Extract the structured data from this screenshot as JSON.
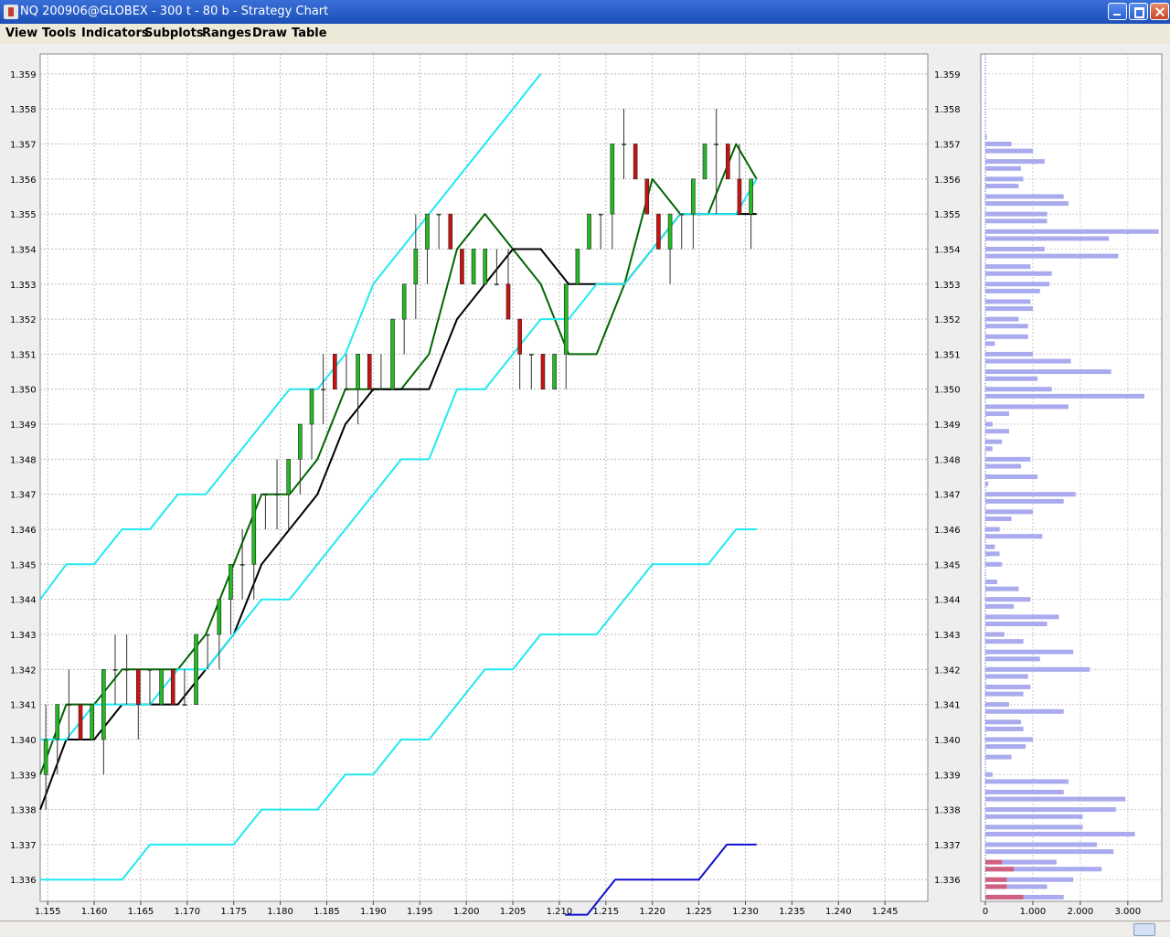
{
  "window": {
    "title": "NQ 200906@GLOBEX - 300 t - 80 b - Strategy Chart"
  },
  "menu": {
    "items": [
      "View",
      "Tools",
      "Indicators",
      "Subplots",
      "Ranges",
      "Draw",
      "Table"
    ]
  },
  "colors": {
    "bull_candle": "#22bb22",
    "bear_candle": "#cc1111",
    "band": "#22e8f0",
    "fast_ma": "#006600",
    "slow_ma": "#000000",
    "low_band": "#1010d0",
    "volume_bar": "#aaaaee",
    "volume_highlight": "#d06080"
  },
  "chart_data": [
    {
      "type": "candlestick",
      "title": "",
      "xlabel": "",
      "ylabel": "",
      "x_ticks": [
        "1.155",
        "1.160",
        "1.165",
        "1.170",
        "1.175",
        "1.180",
        "1.185",
        "1.190",
        "1.195",
        "1.200",
        "1.205",
        "1.210",
        "1.215",
        "1.220",
        "1.225",
        "1.230",
        "1.235",
        "1.240",
        "1.245"
      ],
      "y_ticks": [
        "1.336",
        "1.337",
        "1.338",
        "1.339",
        "1.340",
        "1.341",
        "1.342",
        "1.343",
        "1.344",
        "1.345",
        "1.346",
        "1.347",
        "1.348",
        "1.349",
        "1.350",
        "1.351",
        "1.352",
        "1.353",
        "1.354",
        "1.355",
        "1.356",
        "1.357",
        "1.358",
        "1.359"
      ],
      "xlim": [
        1.1542,
        1.2496
      ],
      "ylim": [
        1.33538,
        1.35957
      ],
      "grid": true,
      "candles": [
        [
          1.339,
          1.341,
          1.338,
          1.34
        ],
        [
          1.34,
          1.341,
          1.339,
          1.341
        ],
        [
          1.341,
          1.342,
          1.34,
          1.341
        ],
        [
          1.341,
          1.341,
          1.34,
          1.34
        ],
        [
          1.34,
          1.341,
          1.34,
          1.341
        ],
        [
          1.34,
          1.342,
          1.339,
          1.342
        ],
        [
          1.342,
          1.343,
          1.341,
          1.342
        ],
        [
          1.342,
          1.343,
          1.341,
          1.342
        ],
        [
          1.342,
          1.342,
          1.34,
          1.341
        ],
        [
          1.342,
          1.342,
          1.341,
          1.342
        ],
        [
          1.341,
          1.342,
          1.341,
          1.342
        ],
        [
          1.342,
          1.342,
          1.341,
          1.341
        ],
        [
          1.341,
          1.342,
          1.341,
          1.341
        ],
        [
          1.341,
          1.343,
          1.341,
          1.343
        ],
        [
          1.343,
          1.343,
          1.342,
          1.343
        ],
        [
          1.343,
          1.344,
          1.342,
          1.344
        ],
        [
          1.344,
          1.345,
          1.343,
          1.345
        ],
        [
          1.345,
          1.346,
          1.344,
          1.345
        ],
        [
          1.345,
          1.347,
          1.344,
          1.347
        ],
        [
          1.347,
          1.347,
          1.346,
          1.347
        ],
        [
          1.347,
          1.348,
          1.346,
          1.347
        ],
        [
          1.347,
          1.348,
          1.346,
          1.348
        ],
        [
          1.348,
          1.349,
          1.347,
          1.349
        ],
        [
          1.349,
          1.35,
          1.348,
          1.35
        ],
        [
          1.35,
          1.351,
          1.349,
          1.35
        ],
        [
          1.351,
          1.351,
          1.35,
          1.35
        ],
        [
          1.35,
          1.351,
          1.35,
          1.35
        ],
        [
          1.35,
          1.351,
          1.349,
          1.351
        ],
        [
          1.351,
          1.351,
          1.35,
          1.35
        ],
        [
          1.35,
          1.351,
          1.35,
          1.35
        ],
        [
          1.35,
          1.352,
          1.35,
          1.352
        ],
        [
          1.352,
          1.353,
          1.351,
          1.353
        ],
        [
          1.353,
          1.355,
          1.352,
          1.354
        ],
        [
          1.354,
          1.355,
          1.353,
          1.355
        ],
        [
          1.355,
          1.355,
          1.354,
          1.355
        ],
        [
          1.355,
          1.355,
          1.354,
          1.354
        ],
        [
          1.354,
          1.354,
          1.353,
          1.353
        ],
        [
          1.353,
          1.354,
          1.353,
          1.354
        ],
        [
          1.353,
          1.354,
          1.353,
          1.354
        ],
        [
          1.353,
          1.354,
          1.353,
          1.353
        ],
        [
          1.353,
          1.354,
          1.352,
          1.352
        ],
        [
          1.352,
          1.352,
          1.35,
          1.351
        ],
        [
          1.351,
          1.351,
          1.35,
          1.351
        ],
        [
          1.351,
          1.351,
          1.35,
          1.35
        ],
        [
          1.35,
          1.351,
          1.35,
          1.351
        ],
        [
          1.351,
          1.353,
          1.35,
          1.353
        ],
        [
          1.353,
          1.354,
          1.353,
          1.354
        ],
        [
          1.354,
          1.355,
          1.354,
          1.355
        ],
        [
          1.355,
          1.355,
          1.354,
          1.355
        ],
        [
          1.355,
          1.357,
          1.354,
          1.357
        ],
        [
          1.357,
          1.358,
          1.356,
          1.357
        ],
        [
          1.357,
          1.357,
          1.356,
          1.356
        ],
        [
          1.356,
          1.356,
          1.355,
          1.355
        ],
        [
          1.355,
          1.355,
          1.354,
          1.354
        ],
        [
          1.354,
          1.355,
          1.353,
          1.355
        ],
        [
          1.355,
          1.355,
          1.354,
          1.355
        ],
        [
          1.355,
          1.356,
          1.354,
          1.356
        ],
        [
          1.356,
          1.357,
          1.356,
          1.357
        ],
        [
          1.357,
          1.358,
          1.355,
          1.357
        ],
        [
          1.357,
          1.357,
          1.356,
          1.356
        ],
        [
          1.356,
          1.357,
          1.355,
          1.355
        ],
        [
          1.355,
          1.356,
          1.354,
          1.356
        ]
      ],
      "series": [
        {
          "x": [
            1.1542,
            1.157,
            1.16,
            1.163,
            1.166,
            1.169,
            1.172,
            1.175,
            1.178,
            1.181,
            1.184,
            1.187,
            1.19,
            1.193,
            1.196,
            1.199,
            1.202,
            1.205,
            1.208,
            1.211,
            1.214,
            1.217,
            1.22,
            1.223,
            1.226,
            1.229,
            1.2312
          ],
          "y": [
            1.339,
            1.341,
            1.341,
            1.342,
            1.342,
            1.342,
            1.343,
            1.345,
            1.347,
            1.347,
            1.348,
            1.35,
            1.35,
            1.35,
            1.351,
            1.354,
            1.355,
            1.354,
            1.353,
            1.351,
            1.351,
            1.353,
            1.356,
            1.355,
            1.355,
            1.357,
            1.356
          ]
        },
        {
          "x": [
            1.1542,
            1.157,
            1.16,
            1.163,
            1.166,
            1.169,
            1.172,
            1.175,
            1.178,
            1.181,
            1.184,
            1.187,
            1.19,
            1.193,
            1.196,
            1.199,
            1.202,
            1.205,
            1.208,
            1.211,
            1.214,
            1.217,
            1.22,
            1.223,
            1.226,
            1.229,
            1.2312
          ],
          "y": [
            1.338,
            1.34,
            1.34,
            1.341,
            1.341,
            1.341,
            1.342,
            1.343,
            1.345,
            1.346,
            1.347,
            1.349,
            1.35,
            1.35,
            1.35,
            1.352,
            1.353,
            1.354,
            1.354,
            1.353,
            1.353,
            1.353,
            1.354,
            1.355,
            1.355,
            1.355,
            1.355
          ]
        },
        {
          "x": [
            1.1542,
            1.157,
            1.16,
            1.163,
            1.166,
            1.169,
            1.172,
            1.175,
            1.178,
            1.181,
            1.184,
            1.187,
            1.19,
            1.193,
            1.196,
            1.199,
            1.202,
            1.205,
            1.208
          ],
          "y": [
            1.344,
            1.345,
            1.345,
            1.346,
            1.346,
            1.347,
            1.347,
            1.348,
            1.349,
            1.35,
            1.35,
            1.351,
            1.353,
            1.354,
            1.355,
            1.356,
            1.357,
            1.358,
            1.359
          ]
        },
        {
          "x": [
            1.1542,
            1.157,
            1.16,
            1.163,
            1.166,
            1.169,
            1.172,
            1.175,
            1.178,
            1.181,
            1.184,
            1.187,
            1.19,
            1.193,
            1.196,
            1.199,
            1.202,
            1.205,
            1.208,
            1.211,
            1.214,
            1.217,
            1.22,
            1.223,
            1.226,
            1.229,
            1.2312
          ],
          "y": [
            1.34,
            1.34,
            1.341,
            1.341,
            1.341,
            1.342,
            1.342,
            1.343,
            1.344,
            1.344,
            1.345,
            1.346,
            1.347,
            1.348,
            1.348,
            1.35,
            1.35,
            1.351,
            1.352,
            1.352,
            1.353,
            1.353,
            1.354,
            1.355,
            1.355,
            1.355,
            1.356
          ]
        },
        {
          "x": [
            1.1542,
            1.157,
            1.16,
            1.163,
            1.166,
            1.169,
            1.172,
            1.175,
            1.178,
            1.181,
            1.184,
            1.187,
            1.19,
            1.193,
            1.196,
            1.199,
            1.202,
            1.205,
            1.208,
            1.211,
            1.214,
            1.217,
            1.22,
            1.223,
            1.226,
            1.229,
            1.2312
          ],
          "y": [
            1.336,
            1.336,
            1.336,
            1.336,
            1.337,
            1.337,
            1.337,
            1.337,
            1.338,
            1.338,
            1.338,
            1.339,
            1.339,
            1.34,
            1.34,
            1.341,
            1.342,
            1.342,
            1.343,
            1.343,
            1.343,
            1.344,
            1.345,
            1.345,
            1.345,
            1.346,
            1.346
          ]
        },
        {
          "x": [
            1.2106,
            1.213,
            1.216,
            1.219,
            1.222,
            1.225,
            1.228,
            1.2312
          ],
          "y": [
            1.335,
            1.335,
            1.336,
            1.336,
            1.336,
            1.336,
            1.337,
            1.337
          ]
        }
      ]
    },
    {
      "type": "bar",
      "orientation": "horizontal",
      "title": "",
      "xlabel": "",
      "ylabel": "",
      "x_ticks": [
        "0",
        "1.000",
        "2.000",
        "3.000"
      ],
      "xlim": [
        0,
        3600
      ],
      "ylim": [
        1.33538,
        1.35957
      ],
      "categories": [
        1.3572,
        1.357,
        1.3568,
        1.3565,
        1.3563,
        1.356,
        1.3558,
        1.3555,
        1.3553,
        1.355,
        1.3548,
        1.3545,
        1.3543,
        1.354,
        1.3538,
        1.3535,
        1.3533,
        1.353,
        1.3528,
        1.3525,
        1.3523,
        1.352,
        1.3518,
        1.3515,
        1.3513,
        1.351,
        1.3508,
        1.3505,
        1.3503,
        1.35,
        1.3498,
        1.3495,
        1.3493,
        1.349,
        1.3488,
        1.3485,
        1.3483,
        1.348,
        1.3478,
        1.3475,
        1.3473,
        1.347,
        1.3468,
        1.3465,
        1.3463,
        1.346,
        1.3458,
        1.3455,
        1.3453,
        1.345,
        1.3448,
        1.3445,
        1.3443,
        1.344,
        1.3438,
        1.3435,
        1.3433,
        1.343,
        1.3428,
        1.3425,
        1.3423,
        1.342,
        1.3418,
        1.3415,
        1.3413,
        1.341,
        1.3408,
        1.3405,
        1.3403,
        1.34,
        1.3398,
        1.3395,
        1.3393,
        1.339,
        1.3388,
        1.3385,
        1.3383,
        1.338,
        1.3378,
        1.3375,
        1.3373,
        1.337,
        1.3368,
        1.3365,
        1.3363,
        1.336,
        1.3358,
        1.3355
      ],
      "values": [
        30,
        550,
        1000,
        1250,
        750,
        800,
        700,
        1650,
        1750,
        1300,
        1300,
        3650,
        2600,
        1250,
        2800,
        950,
        1400,
        1350,
        1150,
        950,
        1000,
        700,
        900,
        900,
        200,
        1000,
        1800,
        2650,
        1100,
        1400,
        3350,
        1750,
        500,
        150,
        500,
        350,
        150,
        950,
        750,
        1100,
        60,
        1900,
        1650,
        1000,
        550,
        300,
        1200,
        200,
        300,
        350,
        0,
        250,
        700,
        950,
        600,
        1550,
        1300,
        400,
        800,
        1850,
        1150,
        2200,
        900,
        950,
        800,
        500,
        1650,
        750,
        800,
        1000,
        850,
        550,
        0,
        150,
        1750,
        1650,
        2950,
        2750,
        2050,
        2050,
        3150,
        2350,
        2700,
        1500,
        2450,
        1850,
        1300,
        1650
      ],
      "highlight_values": [
        0,
        0,
        0,
        0,
        0,
        0,
        0,
        0,
        0,
        0,
        0,
        0,
        0,
        0,
        0,
        0,
        0,
        0,
        0,
        0,
        0,
        0,
        0,
        0,
        0,
        0,
        0,
        0,
        0,
        0,
        0,
        0,
        0,
        0,
        0,
        0,
        0,
        0,
        0,
        0,
        0,
        0,
        0,
        0,
        0,
        0,
        0,
        0,
        0,
        0,
        0,
        0,
        0,
        0,
        0,
        0,
        0,
        0,
        0,
        0,
        0,
        0,
        0,
        0,
        0,
        0,
        0,
        0,
        0,
        0,
        0,
        0,
        0,
        0,
        0,
        0,
        0,
        0,
        0,
        0,
        0,
        0,
        0,
        350,
        600,
        450,
        450,
        800
      ],
      "grid": true
    }
  ]
}
